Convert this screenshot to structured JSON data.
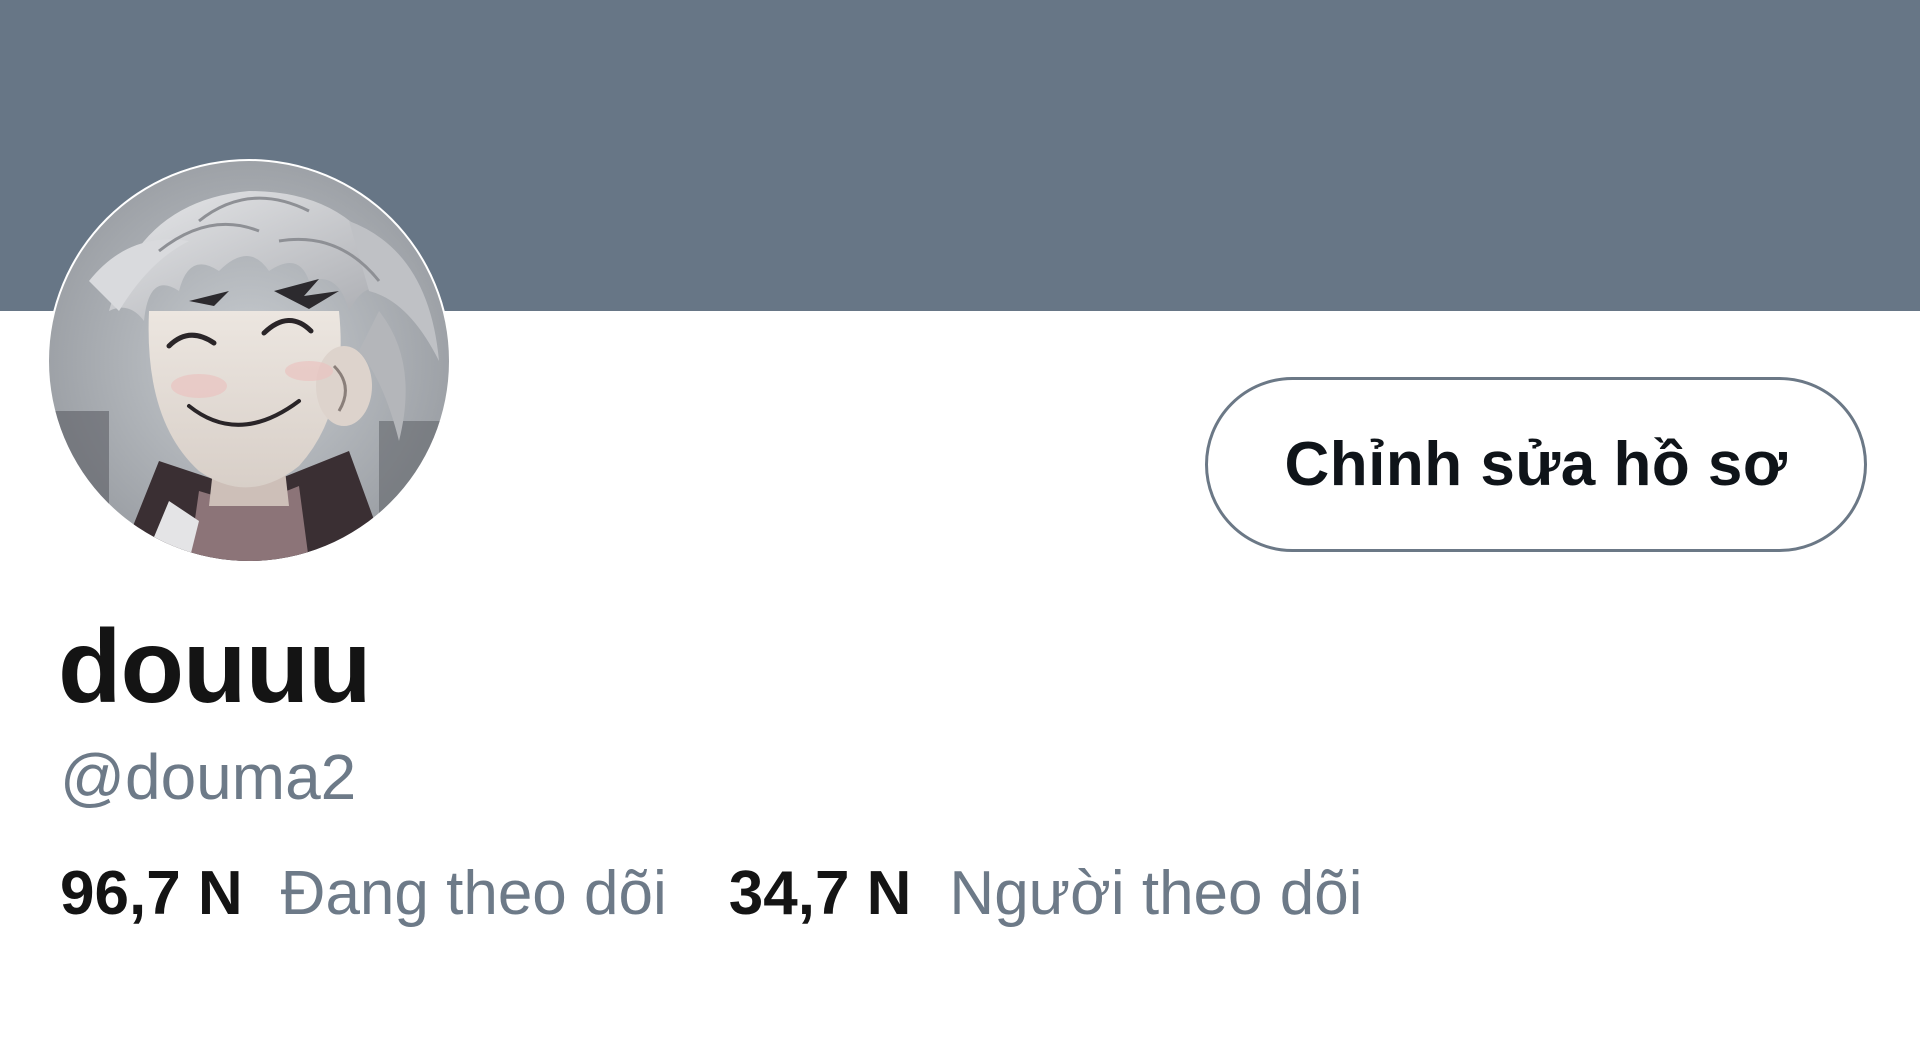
{
  "profile": {
    "display_name": "douuu",
    "handle": "@douma2",
    "edit_button_label": "Chỉnh sửa hồ sơ",
    "banner_color": "#677686",
    "avatar_icon": "anime-character-avatar"
  },
  "stats": {
    "following_count": "96,7 N",
    "following_label": "Đang theo dõi",
    "followers_count": "34,7 N",
    "followers_label": "Người theo dõi"
  },
  "colors": {
    "primary_text": "#141414",
    "secondary_text": "#6d7a88",
    "button_border": "#6b7886"
  }
}
